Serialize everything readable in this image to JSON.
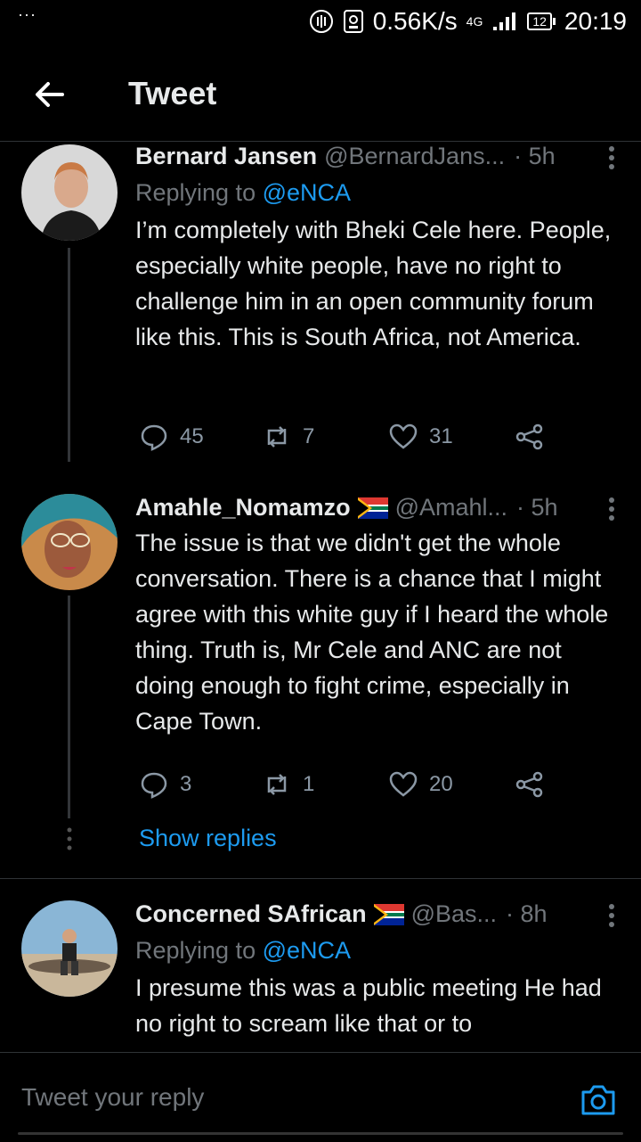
{
  "status_bar": {
    "dots": "···",
    "speed": "0.56K/s",
    "network": "4G",
    "battery": "12",
    "time": "20:19"
  },
  "header": {
    "title": "Tweet"
  },
  "tweets": [
    {
      "name": "Bernard Jansen",
      "handle": "@BernardJans...",
      "time": "· 5h",
      "replying_prefix": "Replying to ",
      "replying_to": "@eNCA",
      "text": "I’m completely with Bheki Cele here. People, especially white people, have no right to challenge him in an open community forum like this. This is South Africa, not America.",
      "replies": "45",
      "retweets": "7",
      "likes": "31"
    },
    {
      "name": "Amahle_Nomamzo",
      "handle": "@Amahl...",
      "time": "· 5h",
      "text": "The issue is that we didn't get the whole conversation. There is a chance that I might agree with this white guy if I heard the whole thing. Truth is, Mr Cele and ANC are not doing enough to fight crime, especially in Cape Town.",
      "replies": "3",
      "retweets": "1",
      "likes": "20"
    },
    {
      "name": "Concerned SAfrican",
      "handle": "@Bas...",
      "time": "· 8h",
      "replying_prefix": "Replying to ",
      "replying_to": "@eNCA",
      "text": "I presume this was a public meeting He had no right to scream like that or to"
    }
  ],
  "show_replies": "Show replies",
  "composer": {
    "placeholder": "Tweet your reply"
  },
  "colors": {
    "accent": "#1d9bf0",
    "muted": "#71767b",
    "background": "#000000"
  }
}
